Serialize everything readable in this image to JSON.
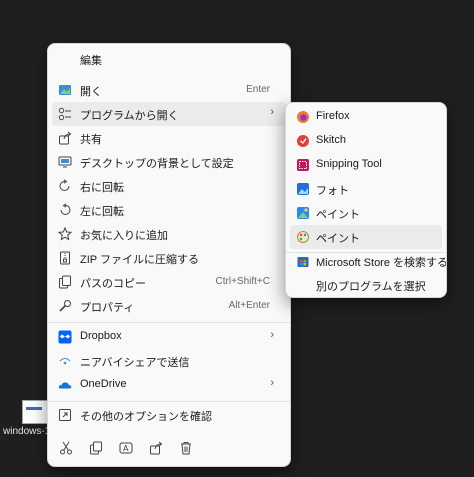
{
  "desktop": {
    "file_name": "windows-1"
  },
  "menu": {
    "header": "編集",
    "items": [
      {
        "label": "開く",
        "shortcut": "Enter",
        "icon": "open-image-icon"
      },
      {
        "label": "プログラムから開く",
        "icon": "open-with-icon",
        "submenu": true
      },
      {
        "label": "共有",
        "icon": "share-icon"
      },
      {
        "label": "デスクトップの背景として設定",
        "icon": "desktop-background-icon"
      },
      {
        "label": "右に回転",
        "icon": "rotate-right-icon"
      },
      {
        "label": "左に回転",
        "icon": "rotate-left-icon"
      },
      {
        "label": "お気に入りに追加",
        "icon": "star-icon"
      },
      {
        "label": "ZIP ファイルに圧縮する",
        "icon": "zip-icon"
      },
      {
        "label": "パスのコピー",
        "shortcut": "Ctrl+Shift+C",
        "icon": "copy-path-icon"
      },
      {
        "label": "プロパティ",
        "shortcut": "Alt+Enter",
        "icon": "wrench-icon"
      },
      {
        "label": "Dropbox",
        "icon": "dropbox-icon",
        "submenu": true
      },
      {
        "label": "ニアバイシェアで送信",
        "icon": "nearby-share-icon"
      },
      {
        "label": "OneDrive",
        "icon": "onedrive-icon",
        "submenu": true
      },
      {
        "label": "その他のオプションを確認",
        "icon": "more-options-icon"
      }
    ],
    "bottom_icons": [
      "cut-icon",
      "copy-icon",
      "rename-icon",
      "share-icon",
      "delete-icon"
    ]
  },
  "submenu": {
    "items": [
      {
        "label": "Firefox",
        "icon": "firefox-icon"
      },
      {
        "label": "Skitch",
        "icon": "skitch-icon"
      },
      {
        "label": "Snipping Tool",
        "icon": "snipping-tool-icon"
      },
      {
        "label": "フォト",
        "icon": "photos-icon"
      },
      {
        "label": "ペイント",
        "icon": "paint-icon"
      },
      {
        "label": "ペイント",
        "icon": "paint-classic-icon"
      },
      {
        "label": "Microsoft Store を検索する",
        "icon": "store-icon"
      },
      {
        "label": "別のプログラムを選択",
        "icon": ""
      }
    ]
  },
  "colors": {
    "menu_bg": "#f9f9f9",
    "highlight": "#ebebeb",
    "desktop": "#1f1f1f"
  }
}
